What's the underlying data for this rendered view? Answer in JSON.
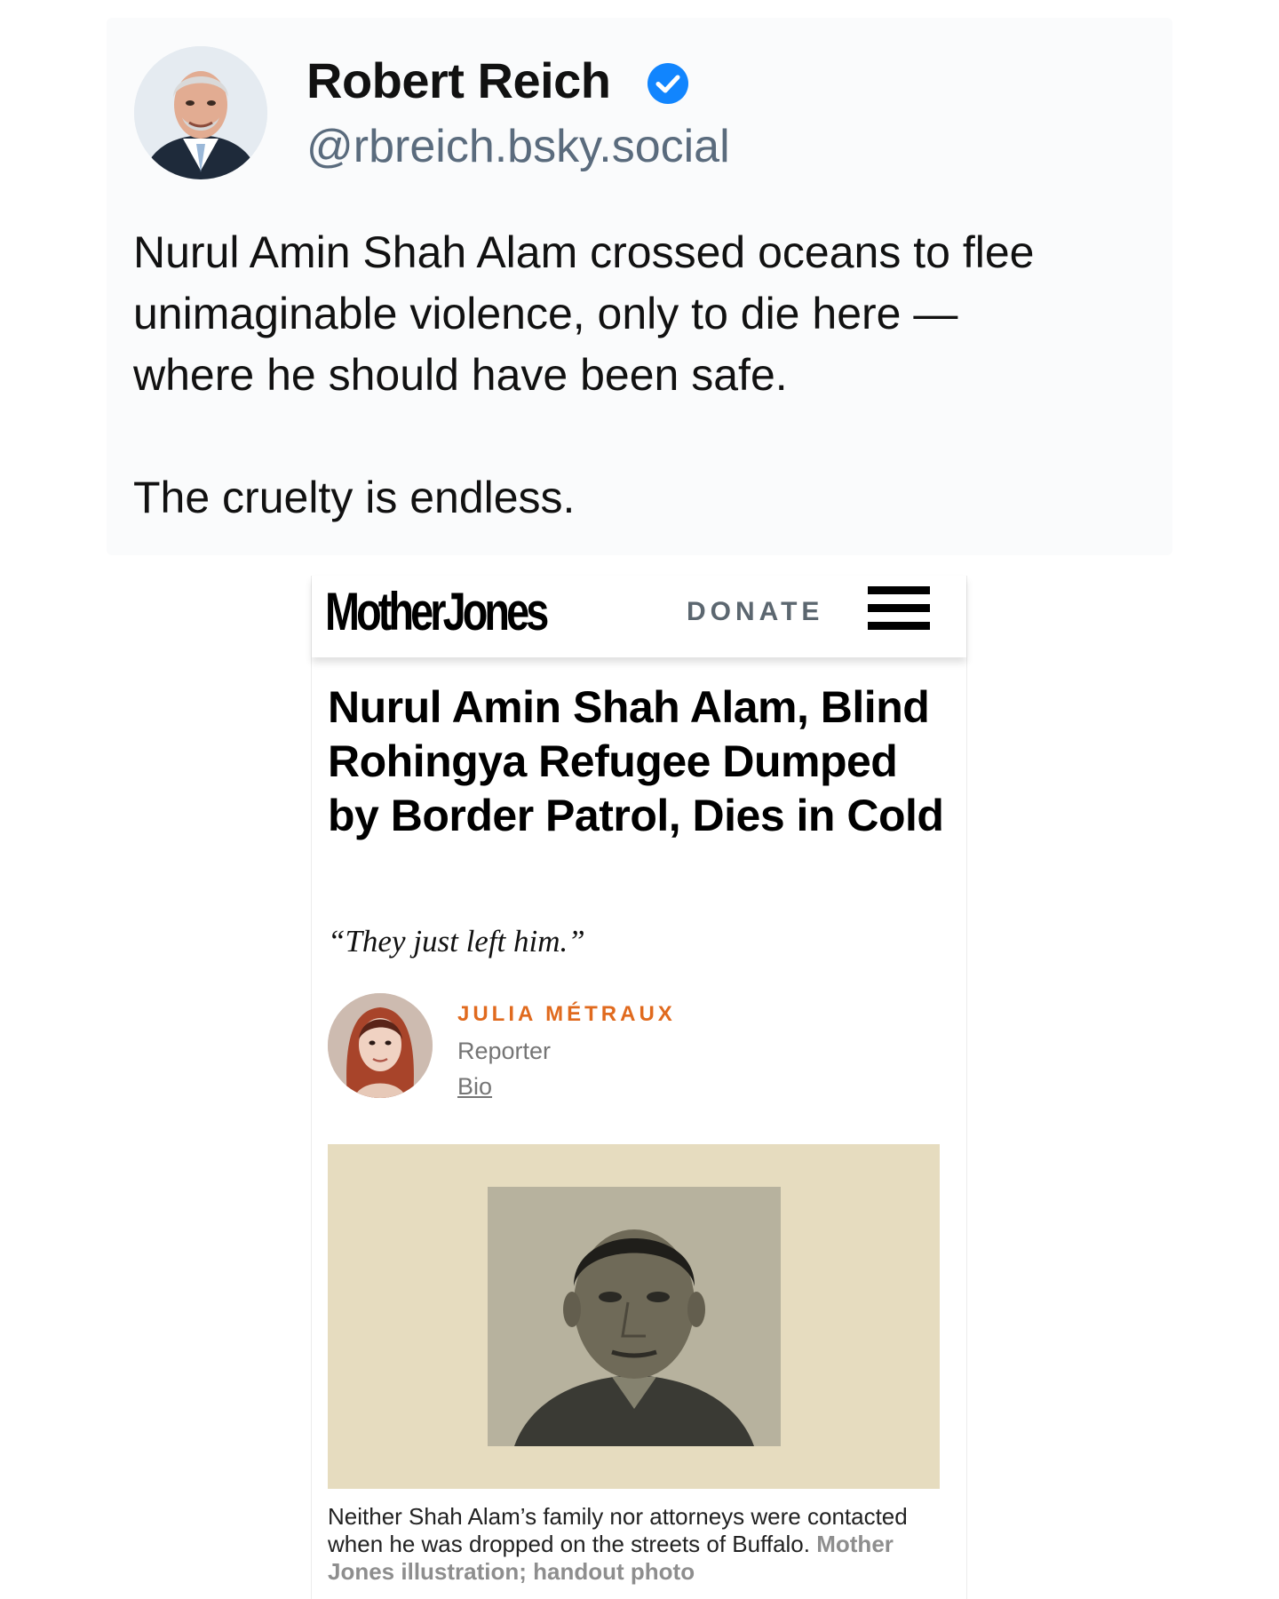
{
  "post": {
    "author_name": "Robert Reich",
    "handle": "@rbreich.bsky.social",
    "verified_icon": "verified-badge-icon",
    "paragraph_1": "Nurul Amin Shah Alam crossed oceans to flee\nunimaginable violence, only to die here —\nwhere he should have been safe.",
    "paragraph_2": "The cruelty is endless."
  },
  "article": {
    "logo": "MotherJones",
    "donate": "DONATE",
    "menu_icon": "hamburger-menu-icon",
    "headline": "Nurul Amin Shah Alam, Blind Rohingya Refugee Dumped by Border Patrol, Dies in Cold",
    "dek": "“They just left him.”",
    "author": {
      "name": "JULIA MÉTRAUX",
      "role": "Reporter",
      "bio": "Bio"
    },
    "caption": {
      "text": "Neither Shah Alam’s family nor attorneys were contacted when he was dropped on the streets of Buffalo.",
      "credit": "Mother Jones illustration; handout photo"
    }
  },
  "colors": {
    "verified": "#1185fe",
    "author_accent": "#e06a1e",
    "hero_background": "#e6dcbf"
  }
}
